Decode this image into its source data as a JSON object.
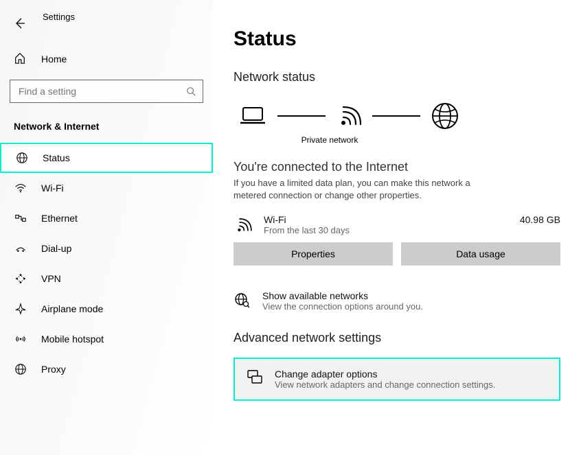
{
  "app_title": "Settings",
  "sidebar": {
    "home_label": "Home",
    "search_placeholder": "Find a setting",
    "section_label": "Network & Internet",
    "items": [
      {
        "label": "Status"
      },
      {
        "label": "Wi-Fi"
      },
      {
        "label": "Ethernet"
      },
      {
        "label": "Dial-up"
      },
      {
        "label": "VPN"
      },
      {
        "label": "Airplane mode"
      },
      {
        "label": "Mobile hotspot"
      },
      {
        "label": "Proxy"
      }
    ]
  },
  "main": {
    "title": "Status",
    "subtitle": "Network status",
    "diagram_caption": "Private network",
    "connected_heading": "You're connected to the Internet",
    "connected_desc": "If you have a limited data plan, you can make this network a metered connection or change other properties.",
    "connection": {
      "name": "Wi-Fi",
      "sub": "From the last 30 days",
      "usage": "40.98 GB"
    },
    "properties_btn": "Properties",
    "datausage_btn": "Data usage",
    "show_networks": {
      "title": "Show available networks",
      "desc": "View the connection options around you."
    },
    "advanced_heading": "Advanced network settings",
    "adapter_card": {
      "title": "Change adapter options",
      "desc": "View network adapters and change connection settings."
    }
  }
}
